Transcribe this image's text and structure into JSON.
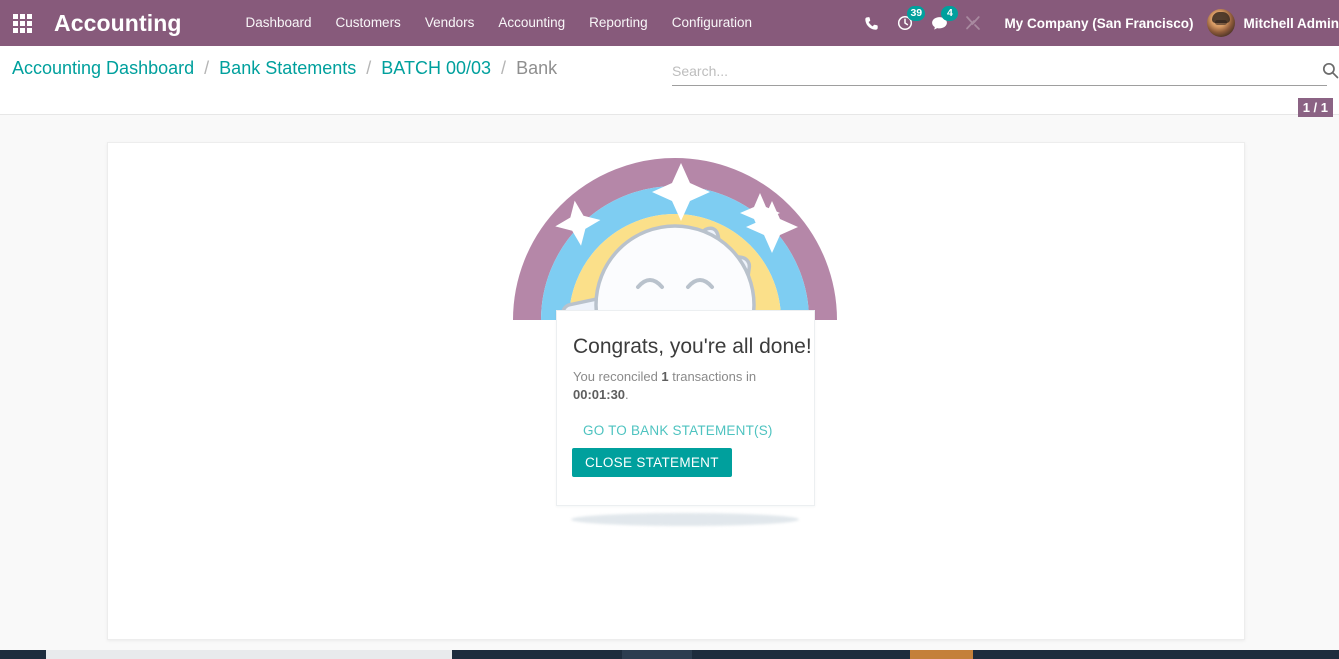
{
  "navbar": {
    "apps_icon": "apps-grid-icon",
    "brand": "Accounting",
    "menu": [
      {
        "label": "Dashboard"
      },
      {
        "label": "Customers"
      },
      {
        "label": "Vendors"
      },
      {
        "label": "Accounting"
      },
      {
        "label": "Reporting"
      },
      {
        "label": "Configuration"
      }
    ],
    "systray": [
      {
        "name": "phone-icon",
        "badge": null
      },
      {
        "name": "activity-clock-icon",
        "badge": "39"
      },
      {
        "name": "messages-icon",
        "badge": "4"
      },
      {
        "name": "debug-tools-icon",
        "badge": null
      }
    ],
    "company": "My Company (San Francisco)",
    "user": "Mitchell Admin",
    "background_color": "#875A7B"
  },
  "control_panel": {
    "breadcrumb": [
      {
        "label": "Accounting Dashboard",
        "active": false
      },
      {
        "label": "Bank Statements",
        "active": false
      },
      {
        "label": "BATCH 00/03",
        "active": false
      },
      {
        "label": "Bank",
        "active": true
      }
    ],
    "separator": "/",
    "search": {
      "placeholder": "Search...",
      "value": "",
      "icon": "search-icon"
    },
    "pager": "1 / 1"
  },
  "rainbow_message": {
    "title": "Congrats, you're all done!",
    "subtitle_prefix": "You reconciled ",
    "count": "1",
    "subtitle_middle": " transactions in ",
    "duration": "00:01:30",
    "subtitle_suffix": ".",
    "link_label": "GO TO BANK STATEMENT(S)",
    "button_label": "CLOSE STATEMENT",
    "button_color": "#00A09D",
    "link_color": "#4ec3c0"
  },
  "rainbow_graphic": {
    "bands": [
      {
        "name": "purple-band",
        "color": "#b587a8"
      },
      {
        "name": "blue-band",
        "color": "#7ecdf2"
      },
      {
        "name": "yellow-band",
        "color": "#fbe08a"
      },
      {
        "name": "orange-band",
        "color": "#fb9a76"
      }
    ],
    "face": {
      "name": "smiley-face",
      "fill": "#fbfcfe",
      "stroke": "#b9c2cc"
    },
    "sparkles": 3,
    "thumbs_up": 2
  },
  "theme": {
    "accent_teal": "#00A09D",
    "brand_purple": "#875A7B",
    "page_background": "#f9f9f9",
    "sheet_background": "#ffffff",
    "taskbar_color": "#1d2c3d",
    "taskbar_accent": "#c4803a"
  }
}
